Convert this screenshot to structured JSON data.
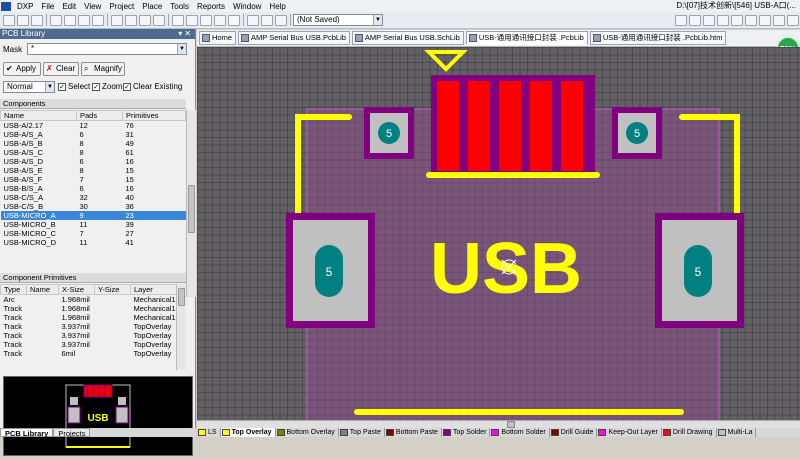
{
  "app": {
    "menu": [
      "DXP",
      "File",
      "Edit",
      "View",
      "Project",
      "Place",
      "Tools",
      "Reports",
      "Window",
      "Help"
    ],
    "title_path": "D:\\[07]技术创新\\[546] USB-A口(..."
  },
  "toolbar": {
    "not_saved": "(Not Saved)"
  },
  "panel": {
    "title": "PCB Library",
    "mask_label": "Mask",
    "mask_value": "*",
    "apply": "Apply",
    "clear": "Clear",
    "magnify": "Magnify",
    "mode": "Normal",
    "opt_select": "Select",
    "opt_zoom": "Zoom",
    "opt_clear_existing": "Clear Existing",
    "components_header": "Components",
    "columns": {
      "name": "Name",
      "pads": "Pads",
      "primitives": "Primitives"
    },
    "components": [
      {
        "name": "USB-A/2.17",
        "pads": "12",
        "primitives": "76"
      },
      {
        "name": "USB-A/S_A",
        "pads": "6",
        "primitives": "31"
      },
      {
        "name": "USB-A/S_B",
        "pads": "8",
        "primitives": "49"
      },
      {
        "name": "USB-A/S_C",
        "pads": "8",
        "primitives": "61"
      },
      {
        "name": "USB-A/S_D",
        "pads": "6",
        "primitives": "16"
      },
      {
        "name": "USB-A/S_E",
        "pads": "8",
        "primitives": "15"
      },
      {
        "name": "USB-A/S_F",
        "pads": "7",
        "primitives": "15"
      },
      {
        "name": "USB-B/S_A",
        "pads": "6",
        "primitives": "16"
      },
      {
        "name": "USB-C/S_A",
        "pads": "32",
        "primitives": "40"
      },
      {
        "name": "USB-C/S_B",
        "pads": "30",
        "primitives": "36"
      },
      {
        "name": "USB-MICRO_A",
        "pads": "9",
        "primitives": "23"
      },
      {
        "name": "USB-MICRO_B",
        "pads": "11",
        "primitives": "39"
      },
      {
        "name": "USB-MICRO_C",
        "pads": "7",
        "primitives": "27"
      },
      {
        "name": "USB-MICRO_D",
        "pads": "11",
        "primitives": "41"
      }
    ],
    "selected_index": 10,
    "primitives_header": "Component Primitives",
    "prim_columns": {
      "type": "Type",
      "name": "Name",
      "xsize": "X-Size",
      "ysize": "Y-Size",
      "layer": "Layer"
    },
    "primitives": [
      {
        "type": "Arc",
        "name": "",
        "xsize": "1.968mil",
        "ysize": "",
        "layer": "Mechanical1"
      },
      {
        "type": "Track",
        "name": "",
        "xsize": "1.968mil",
        "ysize": "",
        "layer": "Mechanical1"
      },
      {
        "type": "Track",
        "name": "",
        "xsize": "1.968mil",
        "ysize": "",
        "layer": "Mechanical1"
      },
      {
        "type": "Track",
        "name": "",
        "xsize": "3.937mil",
        "ysize": "",
        "layer": "TopOverlay"
      },
      {
        "type": "Track",
        "name": "",
        "xsize": "3.937mil",
        "ysize": "",
        "layer": "TopOverlay"
      },
      {
        "type": "Track",
        "name": "",
        "xsize": "3.937mil",
        "ysize": "",
        "layer": "TopOverlay"
      },
      {
        "type": "Track",
        "name": "",
        "xsize": "6mil",
        "ysize": "",
        "layer": "TopOverlay"
      }
    ],
    "bottom_tabs": [
      "PCB Library",
      "Projects"
    ],
    "preview_text": "USB"
  },
  "doc_tabs": [
    {
      "label": "Home"
    },
    {
      "label": "AMP Serial Bus USB.PcbLib"
    },
    {
      "label": "AMP Serial Bus USB.SchLib"
    },
    {
      "label": "USB-通用通讯接口封装 .PcbLib"
    },
    {
      "label": "USB-通用通讯接口封装 .PcbLib.htm"
    }
  ],
  "zoom_level": "73%",
  "footprint": {
    "silk_text": "USB",
    "pad_label": "5"
  },
  "layer_tabs": [
    {
      "label": "LS",
      "color": "#ffff00"
    },
    {
      "label": "Top Overlay",
      "color": "#ffff00",
      "active": true
    },
    {
      "label": "Bottom Overlay",
      "color": "#808000"
    },
    {
      "label": "Top Paste",
      "color": "#808080"
    },
    {
      "label": "Bottom Paste",
      "color": "#800000"
    },
    {
      "label": "Top Solder",
      "color": "#800080"
    },
    {
      "label": "Bottom Solder",
      "color": "#ff00ff"
    },
    {
      "label": "Drill Guide",
      "color": "#800000"
    },
    {
      "label": "Keep-Out Layer",
      "color": "#ff00ff"
    },
    {
      "label": "Drill Drawing",
      "color": "#ff002a"
    },
    {
      "label": "Multi-La",
      "color": "#c0c0c0"
    }
  ],
  "colors": {
    "overlay": "#ffff00",
    "top_pad": "#ff0000",
    "solder": "#800080",
    "multilayer": "#c0c0c0",
    "hole": "#008080",
    "keepout": "#ff00ff"
  }
}
